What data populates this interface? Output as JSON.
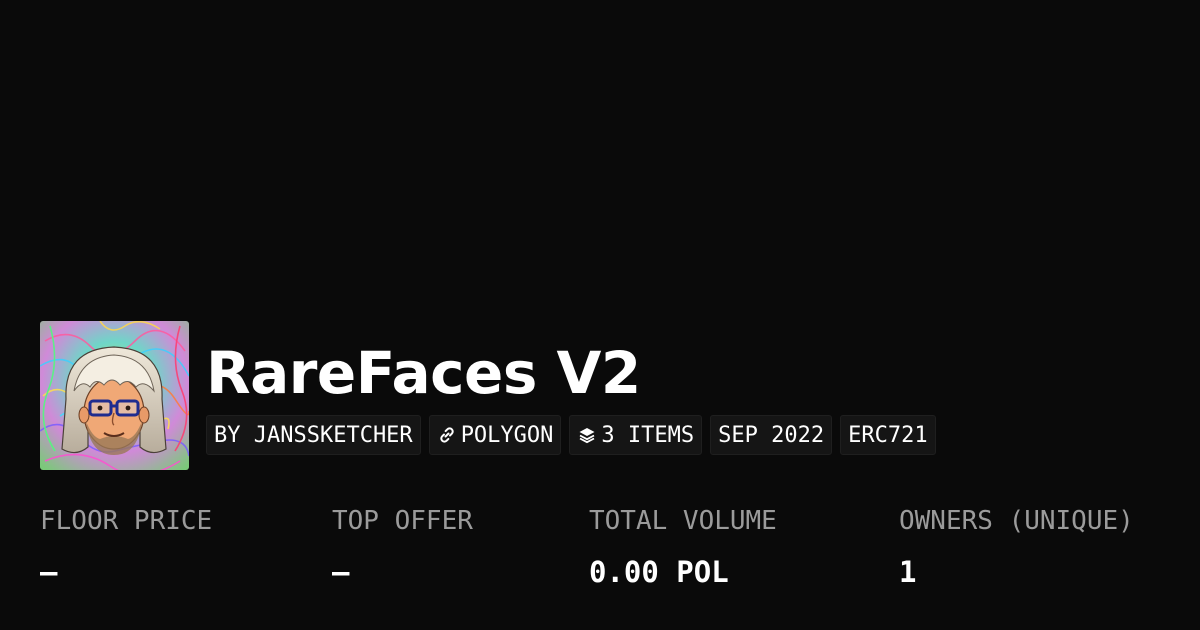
{
  "collection": {
    "name": "RareFaces V2",
    "avatar_icon": "collection-avatar-bearded-face",
    "chips": {
      "creator": "BY JANSSKETCHER",
      "chain": "POLYGON",
      "chain_icon": "link-icon",
      "items": "3 ITEMS",
      "items_icon": "layers-icon",
      "date": "SEP 2022",
      "standard": "ERC721"
    }
  },
  "stats": {
    "floor_price": {
      "label": "FLOOR PRICE",
      "value": "–"
    },
    "top_offer": {
      "label": "TOP OFFER",
      "value": "–"
    },
    "total_volume": {
      "label": "TOTAL VOLUME",
      "value": "0.00 POL"
    },
    "owners": {
      "label": "OWNERS (UNIQUE)",
      "value": "1"
    }
  },
  "colors": {
    "background": "#0a0a0a",
    "chip_background": "#151515",
    "label_gray": "#9b9b9b",
    "text": "#ffffff"
  }
}
